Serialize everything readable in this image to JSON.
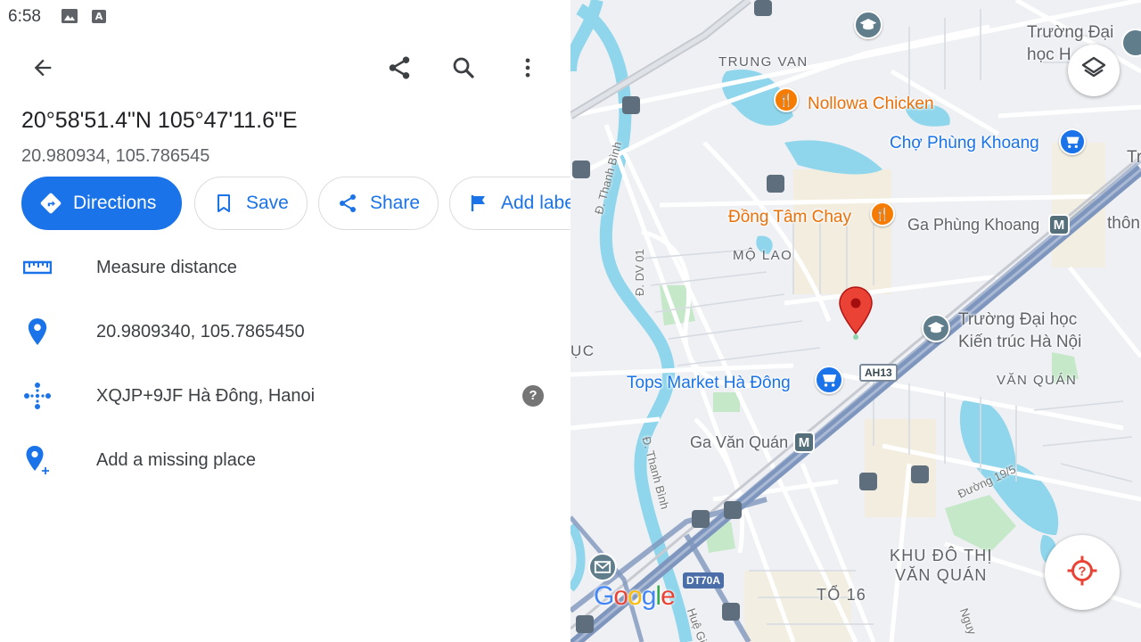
{
  "status_bar": {
    "time": "6:58",
    "icons": [
      "image-icon",
      "a-notification-icon"
    ]
  },
  "top_bar": {
    "back_icon": "arrow-left-icon",
    "actions": [
      "share-icon",
      "search-icon",
      "more-vert-icon"
    ]
  },
  "place": {
    "title": "20°58'51.4\"N 105°47'11.6\"E",
    "subtitle": "20.980934, 105.786545"
  },
  "chips": {
    "directions": "Directions",
    "save": "Save",
    "share": "Share",
    "add_label": "Add label"
  },
  "rows": {
    "measure": "Measure distance",
    "latlng": "20.9809340, 105.7865450",
    "plus_code": "XQJP+9JF Hà Đông, Hanoi",
    "missing_place": "Add a missing place"
  },
  "map": {
    "pois": {
      "nollowa": "Nollowa Chicken",
      "cho_phung_khoang": "Chợ Phùng Khoang",
      "dong_tam_chay": "Đồng Tâm Chay",
      "ga_phung_khoang": "Ga Phùng Khoang",
      "truong_kien_truc_1": "Trường Đại học",
      "truong_kien_truc_2": "Kiến trúc Hà Nội",
      "tops_market": "Tops Market Hà Đông",
      "ga_van_quan": "Ga Văn Quán",
      "truong_top_1": "Trường Đại",
      "truong_top_2": "học H",
      "edge_tr": "Tr",
      "edge_thon": "thôn"
    },
    "areas": {
      "trung_van": "TRUNG VAN",
      "mo_lao": "MỘ LAO",
      "van_quan": "VĂN QUÁN",
      "khu_do_thi_1": "KHU ĐÔ THỊ",
      "khu_do_thi_2": "VĂN QUÁN",
      "to_16": "TỔ 16",
      "edge_uc": "ỤC"
    },
    "streets": {
      "thanh_binh_top": "Đ. Thanh Bình",
      "dv01": "Đ. DV 01",
      "thanh_binh_bottom": "Đ. Thanh Bình",
      "duong_19_5": "Đường 19/5",
      "nguy": "Nguy",
      "hue_gi": "Huệ Gi"
    },
    "shields": {
      "ah13": "AH13",
      "dt70a": "DT70A"
    },
    "logo": "Google",
    "colors": {
      "water": "#8fd6ec",
      "park": "#c5e8c9",
      "highway": "#7e96bd",
      "road": "#ffffff",
      "land": "#eef0f3",
      "pin": "#ea4335"
    }
  }
}
